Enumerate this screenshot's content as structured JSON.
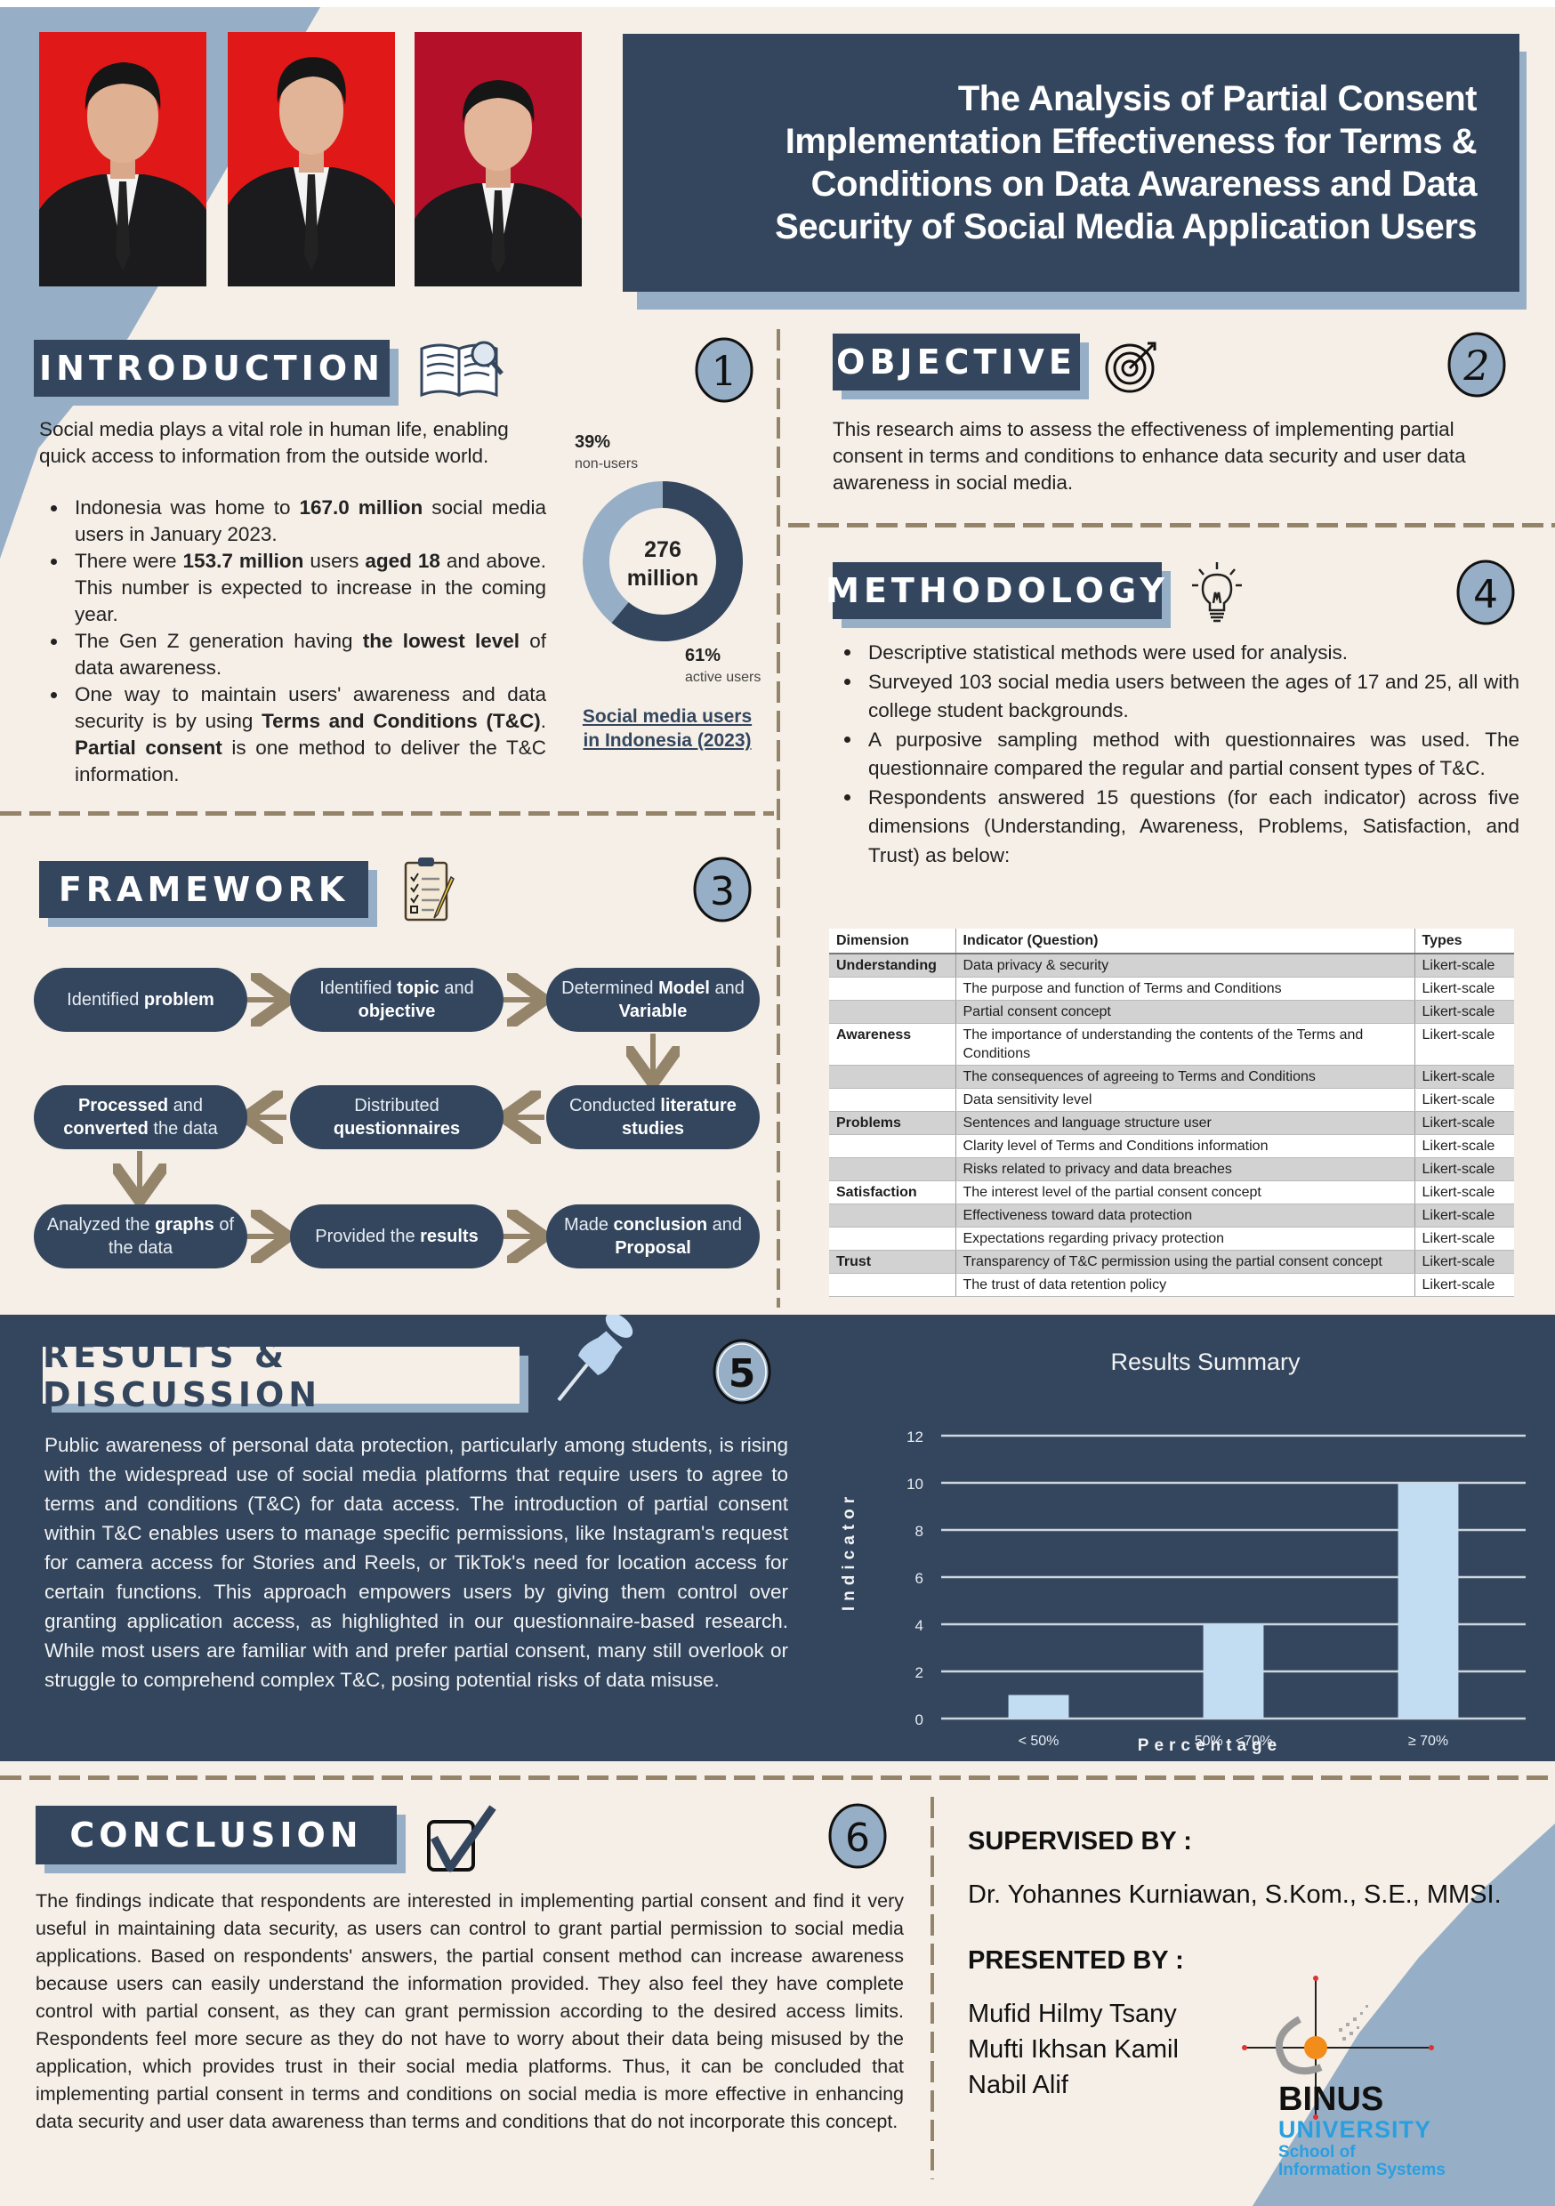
{
  "title": "The Analysis of Partial Consent Implementation Effectiveness for Terms & Conditions on Data Awareness and Data Security of Social Media Application Users",
  "title_lines": [
    "The Analysis of Partial Consent",
    "Implementation Effectiveness for Terms &",
    "Conditions on Data Awareness and Data",
    "Security of Social Media Application Users"
  ],
  "photos": [
    {
      "label": "author-photo-1",
      "bg": "#e01818"
    },
    {
      "label": "author-photo-2",
      "bg": "#e01818"
    },
    {
      "label": "author-photo-3",
      "bg": "#b5102a"
    }
  ],
  "colors": {
    "navy": "#33465e",
    "steel": "#97afc6",
    "cream": "#f6efe7",
    "dash": "#93846a",
    "bar": "#c2dcf2"
  },
  "introduction": {
    "heading": "INTRODUCTION",
    "number": "1",
    "lead": "Social media plays a vital role in human life, enabling quick access to information from the outside world.",
    "bullets": [
      {
        "parts": [
          [
            "Indonesia was home to ",
            false
          ],
          [
            "167.0 million",
            true
          ],
          [
            " social media users in January 2023.",
            false
          ]
        ]
      },
      {
        "parts": [
          [
            "There were ",
            false
          ],
          [
            "153.7 million",
            true
          ],
          [
            " users ",
            false
          ],
          [
            "aged 18",
            true
          ],
          [
            " and above. This number is expected to increase in the coming year.",
            false
          ]
        ]
      },
      {
        "parts": [
          [
            "The Gen Z generation having ",
            false
          ],
          [
            "the lowest level",
            true
          ],
          [
            " of data awareness.",
            false
          ]
        ]
      },
      {
        "parts": [
          [
            "One way to maintain users' awareness and data security is by using ",
            false
          ],
          [
            "Terms and Conditions (T&C)",
            true
          ],
          [
            ". ",
            false
          ],
          [
            "Partial consent",
            true
          ],
          [
            " is one method to deliver the T&C information.",
            false
          ]
        ]
      }
    ],
    "donut": {
      "center_top": "276",
      "center_bottom": "million",
      "non_users_pct": "39%",
      "non_users_label": "non-users",
      "active_pct": "61%",
      "active_label": "active users",
      "active_fraction": 0.61,
      "caption_line1": "Social media users",
      "caption_line2": "in Indonesia (2023)"
    }
  },
  "objective": {
    "heading": "OBJECTIVE",
    "number": "2",
    "text": "This research aims to assess the effectiveness of implementing partial consent in terms and conditions to enhance data security and user data awareness in social media."
  },
  "framework": {
    "heading": "FRAMEWORK",
    "number": "3",
    "nodes": [
      {
        "parts": [
          [
            "Identified ",
            false
          ],
          [
            "problem",
            true
          ]
        ]
      },
      {
        "parts": [
          [
            "Identified ",
            false
          ],
          [
            "topic",
            true
          ],
          [
            " and ",
            false
          ],
          [
            "objective",
            true
          ]
        ]
      },
      {
        "parts": [
          [
            "Determined ",
            false
          ],
          [
            "Model",
            true
          ],
          [
            " and ",
            false
          ],
          [
            "Variable",
            true
          ]
        ]
      },
      {
        "parts": [
          [
            "Conducted ",
            false
          ],
          [
            "literature studies",
            true
          ]
        ]
      },
      {
        "parts": [
          [
            "Distributed ",
            false
          ],
          [
            "questionnaires",
            true
          ]
        ]
      },
      {
        "parts": [
          [
            "Processed",
            true
          ],
          [
            " and ",
            false
          ],
          [
            "converted",
            true
          ],
          [
            " the data",
            false
          ]
        ]
      },
      {
        "parts": [
          [
            "Analyzed the ",
            false
          ],
          [
            "graphs",
            true
          ],
          [
            " of the data",
            false
          ]
        ]
      },
      {
        "parts": [
          [
            "Provided the ",
            false
          ],
          [
            "results",
            true
          ]
        ]
      },
      {
        "parts": [
          [
            "Made ",
            false
          ],
          [
            "conclusion",
            true
          ],
          [
            " and ",
            false
          ],
          [
            "Proposal",
            true
          ]
        ]
      }
    ]
  },
  "methodology": {
    "heading": "METHODOLOGY",
    "number": "4",
    "bullets": [
      "Descriptive statistical methods were used for analysis.",
      "Surveyed 103 social media users between the ages of 17 and 25, all with college student backgrounds.",
      "A purposive sampling method with questionnaires was used. The questionnaire compared the regular and partial consent types of T&C.",
      "Respondents answered 15 questions (for each indicator) across five dimensions (Understanding, Awareness, Problems, Satisfaction, and Trust) as below:"
    ],
    "table": {
      "headers": [
        "Dimension",
        "Indicator (Question)",
        "Types"
      ],
      "rows": [
        [
          "Understanding",
          "Data privacy & security",
          "Likert-scale"
        ],
        [
          "",
          "The purpose and function of Terms and Conditions",
          "Likert-scale"
        ],
        [
          "",
          "Partial consent concept",
          "Likert-scale"
        ],
        [
          "Awareness",
          "The importance of understanding the contents of the Terms and Conditions",
          "Likert-scale"
        ],
        [
          "",
          "The consequences of agreeing to Terms and Conditions",
          "Likert-scale"
        ],
        [
          "",
          "Data sensitivity level",
          "Likert-scale"
        ],
        [
          "Problems",
          "Sentences and language structure user",
          "Likert-scale"
        ],
        [
          "",
          "Clarity level of Terms and Conditions information",
          "Likert-scale"
        ],
        [
          "",
          "Risks related to privacy and data breaches",
          "Likert-scale"
        ],
        [
          "Satisfaction",
          "The interest level of the partial consent concept",
          "Likert-scale"
        ],
        [
          "",
          "Effectiveness toward data protection",
          "Likert-scale"
        ],
        [
          "",
          "Expectations regarding privacy protection",
          "Likert-scale"
        ],
        [
          "Trust",
          "Transparency of T&C permission using the partial consent concept",
          "Likert-scale"
        ],
        [
          "",
          "The trust of data retention policy",
          "Likert-scale"
        ]
      ]
    }
  },
  "results": {
    "heading": "RESULTS & DISCUSSION",
    "number": "5",
    "text": "Public awareness of personal data protection, particularly among students, is rising with the widespread use of social media platforms that require users to agree to terms and conditions (T&C) for data access. The introduction of partial consent within T&C enables users to manage specific permissions, like Instagram's request for camera access for Stories and Reels, or TikTok's need for location access for certain functions. This approach empowers users by giving them control over granting application access, as highlighted in our questionnaire-based research. While most users are familiar with and prefer partial consent, many still overlook or struggle to comprehend complex T&C, posing potential risks of data misuse."
  },
  "chart_data": {
    "type": "bar",
    "title": "Results Summary",
    "xlabel": "Percentage",
    "ylabel": "Indicator",
    "categories": [
      "< 50%",
      "50% - <70%",
      "≥ 70%"
    ],
    "values": [
      1,
      4,
      10
    ],
    "ylim": [
      0,
      12
    ],
    "yticks": [
      0,
      2,
      4,
      6,
      8,
      10,
      12
    ],
    "grid": true,
    "legend": "none"
  },
  "conclusion": {
    "heading": "CONCLUSION",
    "number": "6",
    "text": "The findings indicate that respondents are interested in implementing partial consent and find it very useful in maintaining data security, as users can control to grant partial permission to social media applications. Based on respondents' answers, the partial consent method can increase awareness because users can easily understand the information provided. They also feel they have complete control with partial consent, as they can grant permission according to the desired access limits. Respondents feel more secure as they do not have to worry about their data being misused by the application, which provides trust in their social media platforms. Thus, it can be concluded that implementing partial consent in terms and conditions on social media is more effective in enhancing data security and user data awareness than terms and conditions that do not incorporate this concept."
  },
  "credits": {
    "supervised_label": "SUPERVISED BY :",
    "supervisor": "Dr. Yohannes Kurniawan, S.Kom., S.E., MMSI.",
    "presented_label": "PRESENTED BY :",
    "presenters": [
      "Mufid Hilmy Tsany",
      "Mufti Ikhsan Kamil",
      "Nabil Alif"
    ]
  },
  "logo": {
    "brand": "BINUS",
    "line2": "UNIVERSITY",
    "line3": "School of",
    "line4": "Information Systems"
  }
}
